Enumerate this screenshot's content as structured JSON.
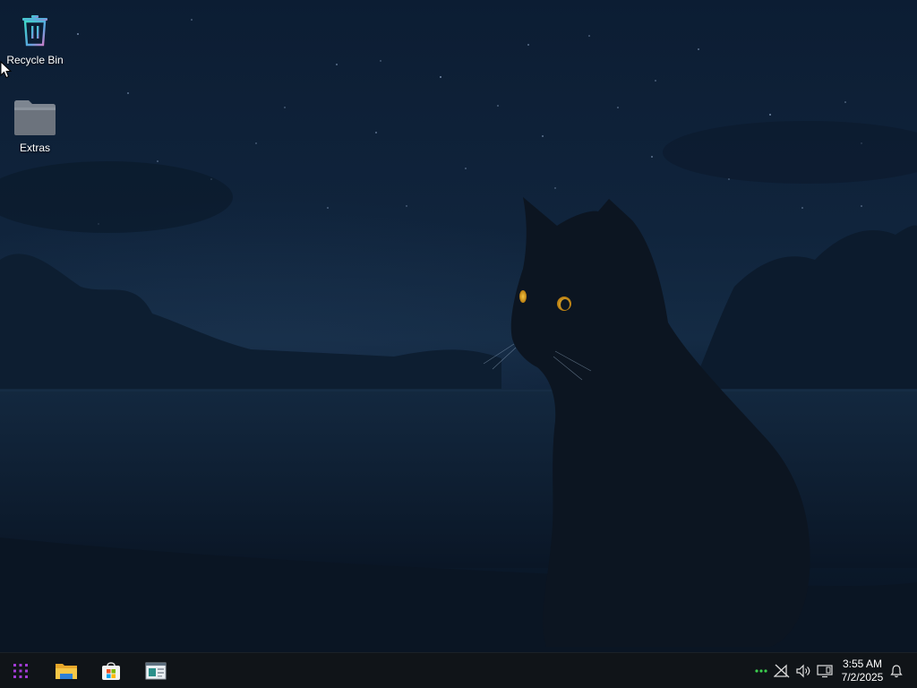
{
  "desktop": {
    "icons": [
      {
        "label": "Recycle Bin",
        "icon": "recycle-bin-icon"
      },
      {
        "label": "Extras",
        "icon": "folder-icon"
      }
    ]
  },
  "taskbar": {
    "start": {
      "icon": "apps-grid-icon"
    },
    "pinned": [
      {
        "icon": "file-explorer-icon"
      },
      {
        "icon": "store-icon"
      },
      {
        "icon": "app-window-icon"
      }
    ],
    "tray": {
      "overflow_icon": "more-dots-icon",
      "network_icon": "network-disconnected-icon",
      "volume_icon": "speaker-icon",
      "display_icon": "display-icon",
      "notification_icon": "bell-icon"
    },
    "clock": {
      "time": "3:55 AM",
      "date": "7/2/2025"
    }
  },
  "colors": {
    "taskbar_bg": "#101418",
    "start_accent": "#a23bd6",
    "tray_dots": "#3ccf4e",
    "cat_eyes": "#e8b020"
  }
}
